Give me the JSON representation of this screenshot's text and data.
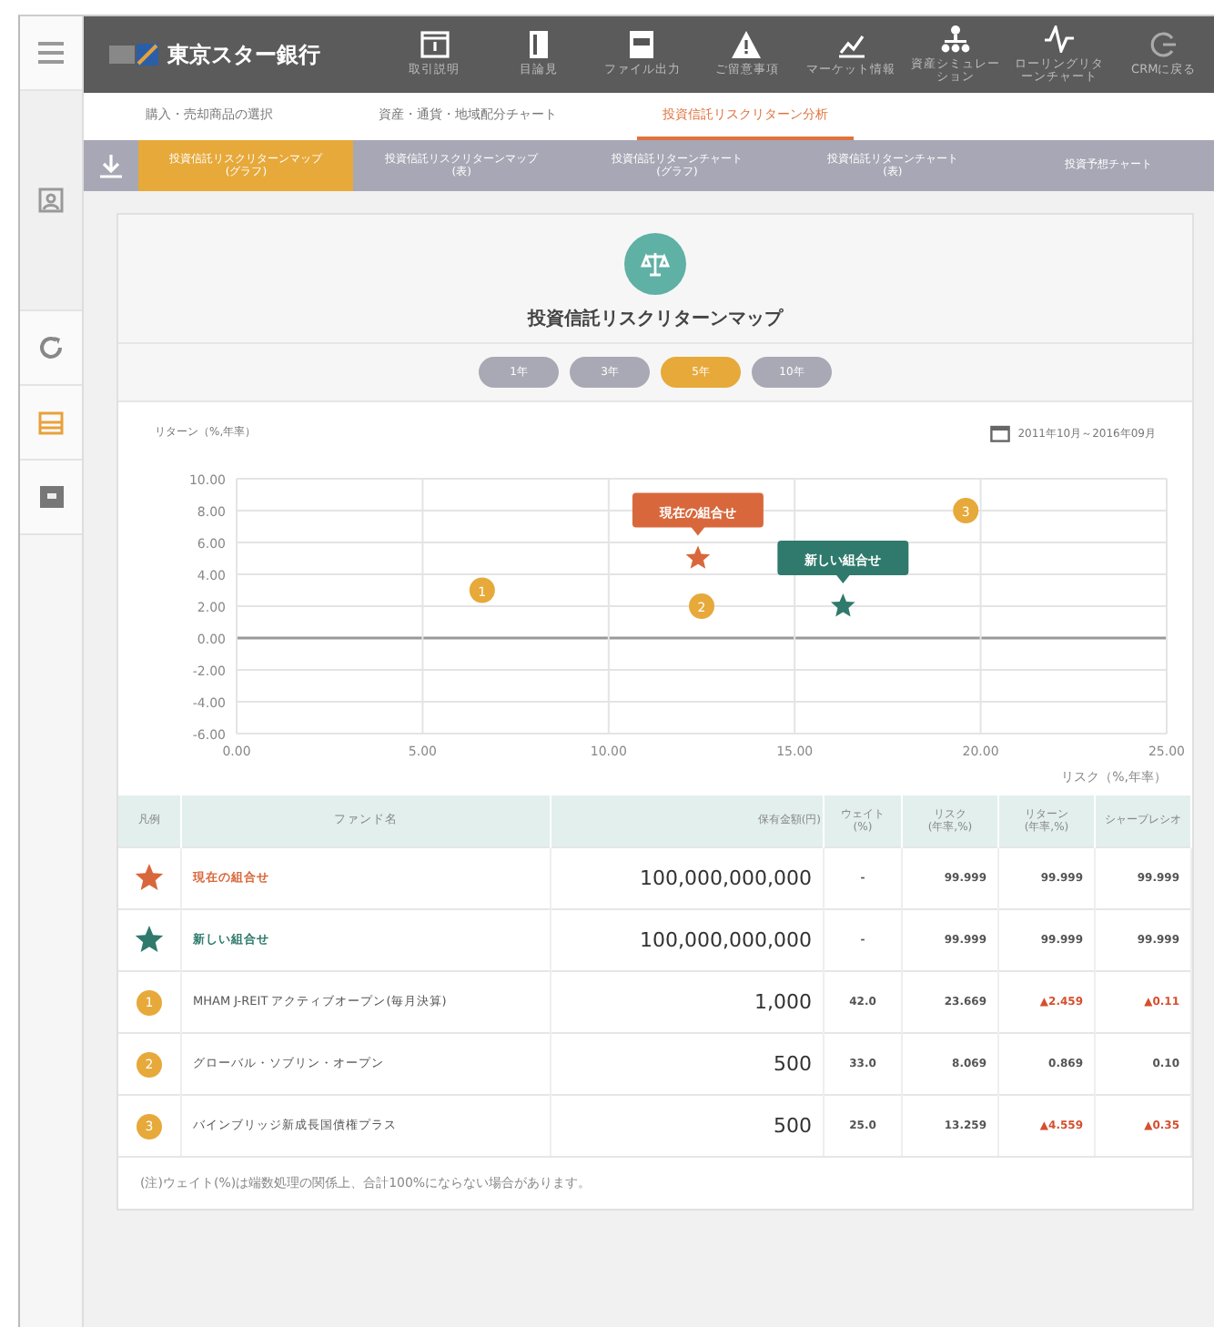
{
  "sidebar": {
    "items": [
      {
        "kind": "menu",
        "selected": false
      },
      {
        "kind": "person",
        "selected": false
      },
      {
        "kind": "refresh",
        "selected": false
      },
      {
        "kind": "list",
        "selected": true
      },
      {
        "kind": "box",
        "selected": false
      }
    ]
  },
  "header": {
    "logo": "東京スター銀行",
    "items": [
      {
        "kind": "doc",
        "label": "取引説明"
      },
      {
        "kind": "book",
        "label": "目論見"
      },
      {
        "kind": "file",
        "label": "ファイル出力"
      },
      {
        "kind": "warn",
        "label": "ご留意事項"
      },
      {
        "kind": "market",
        "label": "マーケット情報"
      },
      {
        "kind": "tree",
        "label": "資産シミュレーション"
      },
      {
        "kind": "wave",
        "label": "ローリングリターンチャート"
      },
      {
        "kind": "back",
        "label": "CRMに戻る"
      }
    ]
  },
  "tabs": [
    {
      "label": "購入・売却商品の選択",
      "selected": false
    },
    {
      "label": "資産・通貨・地域配分チャート",
      "selected": false
    },
    {
      "label": "投資信託リスクリターン分析",
      "selected": true
    }
  ],
  "subtabs": [
    {
      "label": "投資信託リスクリターンマップ\n(グラフ)",
      "selected": true
    },
    {
      "label": "投資信託リスクリターンマップ\n(表)",
      "selected": false
    },
    {
      "label": "投資信託リターンチャート\n(グラフ)",
      "selected": false
    },
    {
      "label": "投資信託リターンチャート\n(表)",
      "selected": false
    },
    {
      "label": "投資予想チャート",
      "selected": false
    }
  ],
  "title": "投資信託リスクリターンマップ",
  "periods": [
    {
      "label": "1年",
      "selected": false
    },
    {
      "label": "3年",
      "selected": false
    },
    {
      "label": "5年",
      "selected": true
    },
    {
      "label": "10年",
      "selected": false
    }
  ],
  "date_range": "2011年10月～2016年09月",
  "chart_data": {
    "type": "scatter",
    "grid": true,
    "xlabel": "リスク（%,年率）",
    "ylabel": "リターン（%,年率）",
    "xlim": [
      0,
      25
    ],
    "ylim": [
      -6,
      10
    ],
    "xticks": [
      {
        "value": 0,
        "label": "0.00"
      },
      {
        "value": 5,
        "label": "5.00"
      },
      {
        "value": 10,
        "label": "10.00"
      },
      {
        "value": 15,
        "label": "15.00"
      },
      {
        "value": 20,
        "label": "20.00"
      },
      {
        "value": 25,
        "label": "25.00"
      }
    ],
    "yticks": [
      {
        "value": 10,
        "label": "10.00"
      },
      {
        "value": 8,
        "label": "8.00"
      },
      {
        "value": 6,
        "label": "6.00"
      },
      {
        "value": 4,
        "label": "4.00"
      },
      {
        "value": 2,
        "label": "2.00"
      },
      {
        "value": 0,
        "label": "0.00"
      },
      {
        "value": -2,
        "label": "-2.00"
      },
      {
        "value": -4,
        "label": "-4.00"
      },
      {
        "value": -6,
        "label": "-6.00"
      }
    ],
    "series": [
      {
        "name": "現在の組合せ",
        "color": "#d8683c",
        "x": [
          12.4
        ],
        "values": [
          5.0
        ]
      },
      {
        "name": "新しい組合せ",
        "color": "#2f7a6c",
        "x": [
          16.3
        ],
        "values": [
          2.0
        ]
      },
      {
        "name": "1",
        "color": "#e6a93a",
        "x": [
          6.6
        ],
        "values": [
          3.0
        ]
      },
      {
        "name": "2",
        "color": "#e6a93a",
        "x": [
          12.5
        ],
        "values": [
          2.0
        ]
      },
      {
        "name": "3",
        "color": "#e6a93a",
        "x": [
          19.6
        ],
        "values": [
          8.0
        ]
      }
    ]
  },
  "table": {
    "columns": [
      "凡例",
      "ファンド名",
      "保有金額(円)",
      "ウェイト\n(%)",
      "リスク\n(年率,%)",
      "リターン\n(年率,%)",
      "シャープレシオ"
    ],
    "rows": [
      {
        "kind": "star",
        "color": "#d8683c",
        "name": "現在の組合せ",
        "amount": "100,000,000,000",
        "weight": "-",
        "risk": "99.999",
        "ret": "99.999",
        "ret_negative": false,
        "sharpe": "99.999",
        "sharpe_negative": false
      },
      {
        "kind": "star",
        "color": "#2f7a6c",
        "name": "新しい組合せ",
        "amount": "100,000,000,000",
        "weight": "-",
        "risk": "99.999",
        "ret": "99.999",
        "ret_negative": false,
        "sharpe": "99.999",
        "sharpe_negative": false
      },
      {
        "kind": "dot",
        "marker": "1",
        "name": "MHAM J-REIT アクティブオープン(毎月決算)",
        "amount": "1,000",
        "weight": "42.0",
        "risk": "23.669",
        "ret": "▲2.459",
        "ret_negative": true,
        "sharpe": "▲0.11",
        "sharpe_negative": true
      },
      {
        "kind": "dot",
        "marker": "2",
        "name": "グローバル・ソブリン・オープン",
        "amount": "500",
        "weight": "33.0",
        "risk": "8.069",
        "ret": "0.869",
        "ret_negative": false,
        "sharpe": "0.10",
        "sharpe_negative": false
      },
      {
        "kind": "dot",
        "marker": "3",
        "name": "バインブリッジ新成長国債権プラス",
        "amount": "500",
        "weight": "25.0",
        "risk": "13.259",
        "ret": "▲4.559",
        "ret_negative": true,
        "sharpe": "▲0.35",
        "sharpe_negative": true
      }
    ]
  },
  "footnote": "(注)ウェイト(%)は端数処理の関係上、合計100%にならない場合があります。"
}
